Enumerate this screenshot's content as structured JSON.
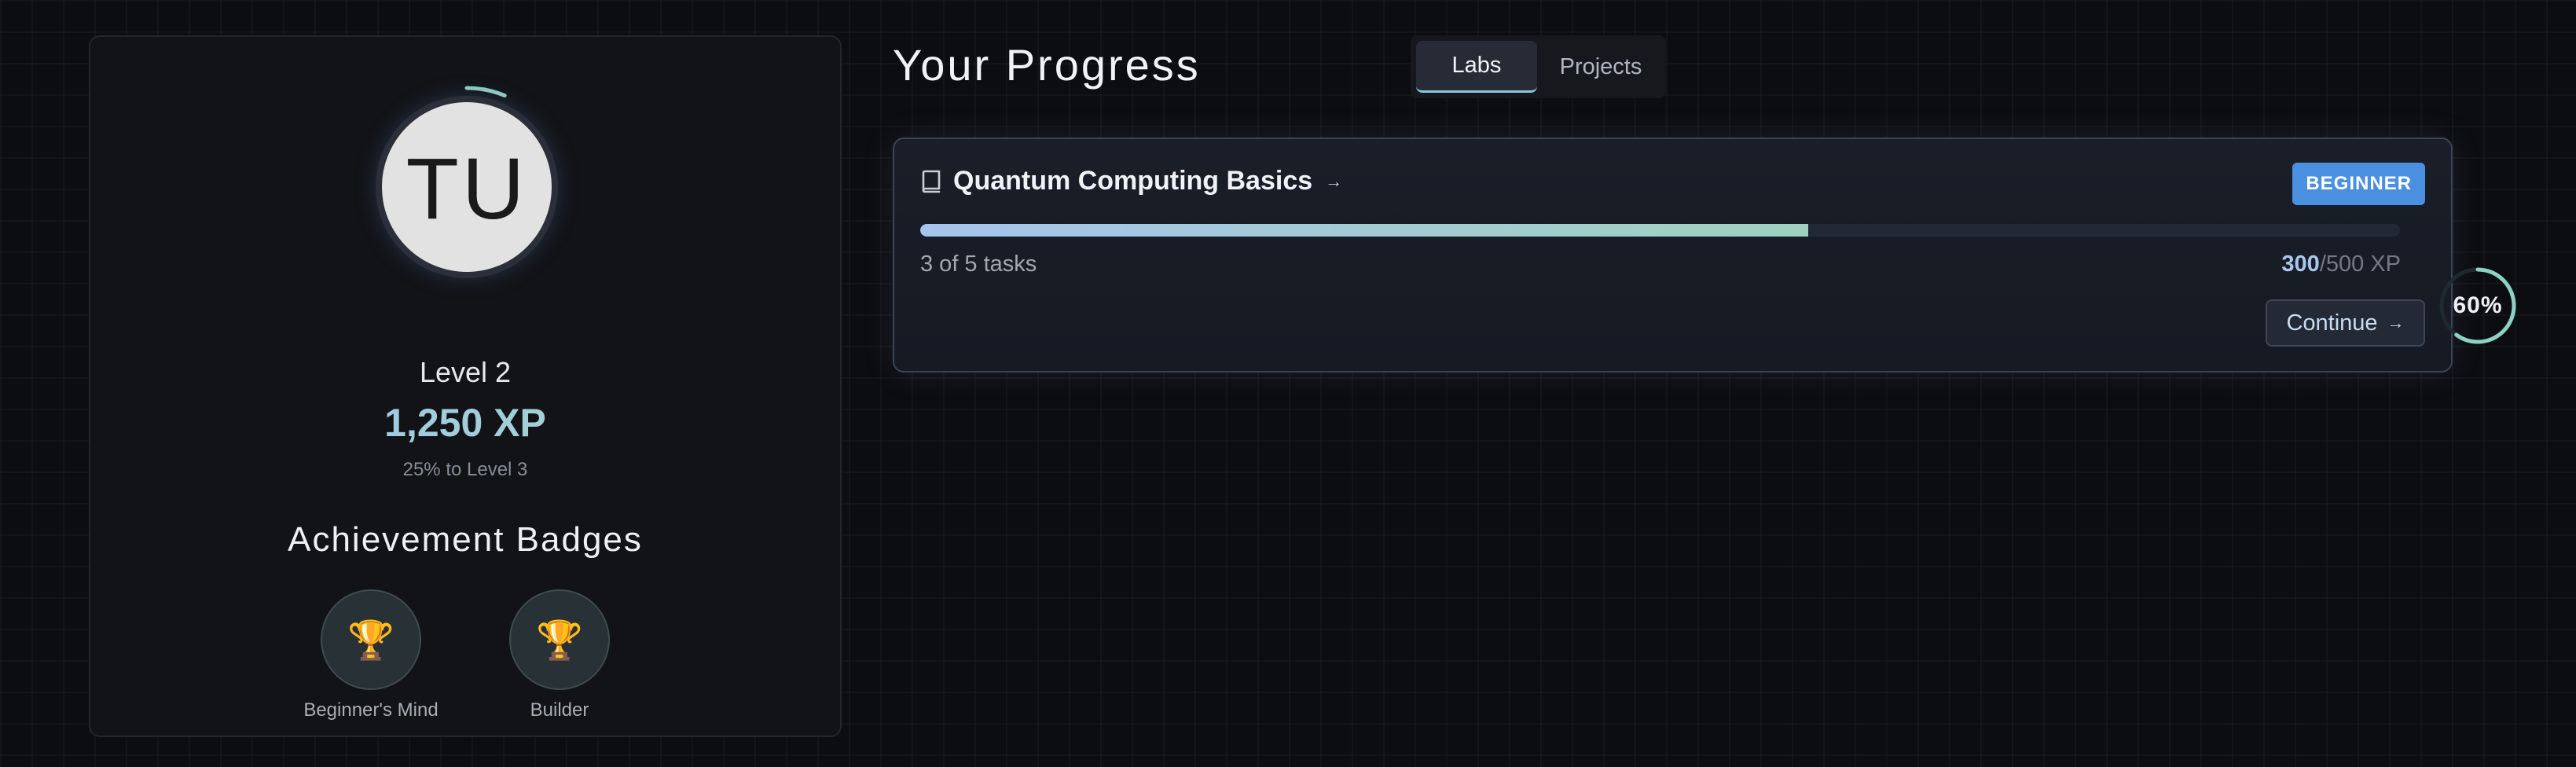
{
  "profile": {
    "initials": "TU",
    "level": "Level 2",
    "xp": "1,250 XP",
    "to_next_level": "25% to Level 3",
    "level_progress": 0.25,
    "badges_title": "Achievement Badges",
    "badges": [
      {
        "icon": "trophy-icon",
        "glyph": "🏆",
        "label": "Beginner's Mind"
      },
      {
        "icon": "trophy-icon",
        "glyph": "🏆",
        "label": "Builder"
      }
    ]
  },
  "header": {
    "title": "Your Progress",
    "tabs": [
      {
        "label": "Labs",
        "active": true
      },
      {
        "label": "Projects",
        "active": false
      }
    ]
  },
  "labs": [
    {
      "title": "Quantum Computing Basics",
      "difficulty": "BEGINNER",
      "tasks_text": "3 of 5 tasks",
      "xp_earned": "300",
      "xp_total": "/500 XP",
      "progress": 0.6,
      "percent_label": "60%",
      "continue_label": "Continue",
      "arrow": "→"
    }
  ],
  "colors": {
    "accent_blue": "#4a8fe0",
    "progress_start": "#a6c4ec",
    "progress_end": "#9ed2be",
    "ring_accent": "#8fd0c4"
  }
}
